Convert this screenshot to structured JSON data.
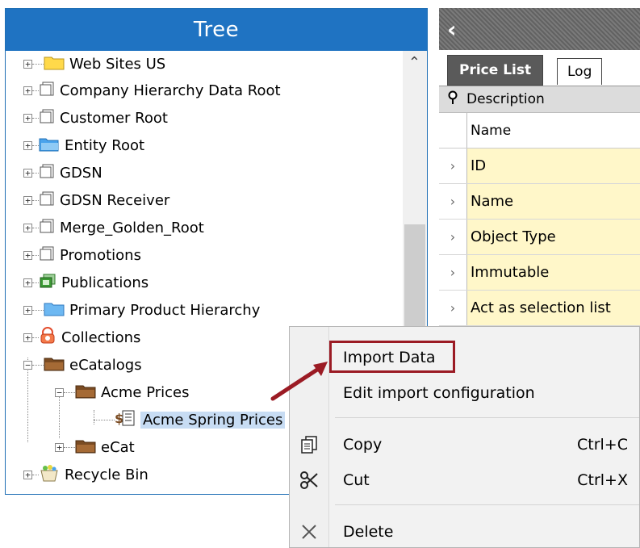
{
  "tree": {
    "title": "Tree",
    "items": [
      {
        "label": "Web Sites US",
        "icon": "folder-yellow-icon",
        "expander": "+"
      },
      {
        "label": "Company Hierarchy Data Root",
        "icon": "cube-icon",
        "expander": "+"
      },
      {
        "label": "Customer Root",
        "icon": "cube-icon",
        "expander": "+"
      },
      {
        "label": "Entity Root",
        "icon": "folder-blue-open-icon",
        "expander": "+"
      },
      {
        "label": "GDSN",
        "icon": "cube-icon",
        "expander": "+"
      },
      {
        "label": "GDSN Receiver",
        "icon": "cube-icon",
        "expander": "+"
      },
      {
        "label": "Merge_Golden_Root",
        "icon": "cube-icon",
        "expander": "+"
      },
      {
        "label": "Promotions",
        "icon": "cube-icon",
        "expander": "+"
      },
      {
        "label": "Publications",
        "icon": "publication-icon",
        "expander": "+"
      },
      {
        "label": "Primary Product Hierarchy",
        "icon": "folder-blue-icon",
        "expander": "+"
      },
      {
        "label": "Collections",
        "icon": "collection-icon",
        "expander": "+"
      },
      {
        "label": "eCatalogs",
        "icon": "folder-brown-icon",
        "expander": "−"
      },
      {
        "label": "Acme Prices",
        "icon": "folder-brown-icon",
        "expander": "−"
      },
      {
        "label": "Acme Spring Prices",
        "icon": "price-list-icon",
        "expander": ""
      },
      {
        "label": "eCat",
        "icon": "folder-brown-icon",
        "expander": "+"
      },
      {
        "label": "Recycle Bin",
        "icon": "recycle-bin-icon",
        "expander": "+"
      }
    ]
  },
  "right_panel": {
    "back_glyph": "‹",
    "tabs": [
      {
        "label": "Price List",
        "active": true
      },
      {
        "label": "Log",
        "active": false
      }
    ],
    "grid": {
      "header": "Description",
      "subheader": "Name",
      "rows": [
        "ID",
        "Name",
        "Object Type",
        "Immutable",
        "Act as selection list"
      ]
    }
  },
  "context_menu": {
    "items": [
      {
        "label": "Import Data",
        "shortcut": "",
        "icon": ""
      },
      {
        "label": "Edit import configuration",
        "shortcut": "",
        "icon": ""
      },
      {
        "label": "Copy",
        "shortcut": "Ctrl+C",
        "icon": "copy-icon"
      },
      {
        "label": "Cut",
        "shortcut": "Ctrl+X",
        "icon": "scissors-icon"
      },
      {
        "label": "Delete",
        "shortcut": "",
        "icon": "delete-x-icon"
      }
    ]
  },
  "colors": {
    "tree_header": "#1f73c2",
    "highlight": "#9b1b24",
    "selected_row": "#c7dcf3",
    "grid_cell": "#fff7c9"
  }
}
